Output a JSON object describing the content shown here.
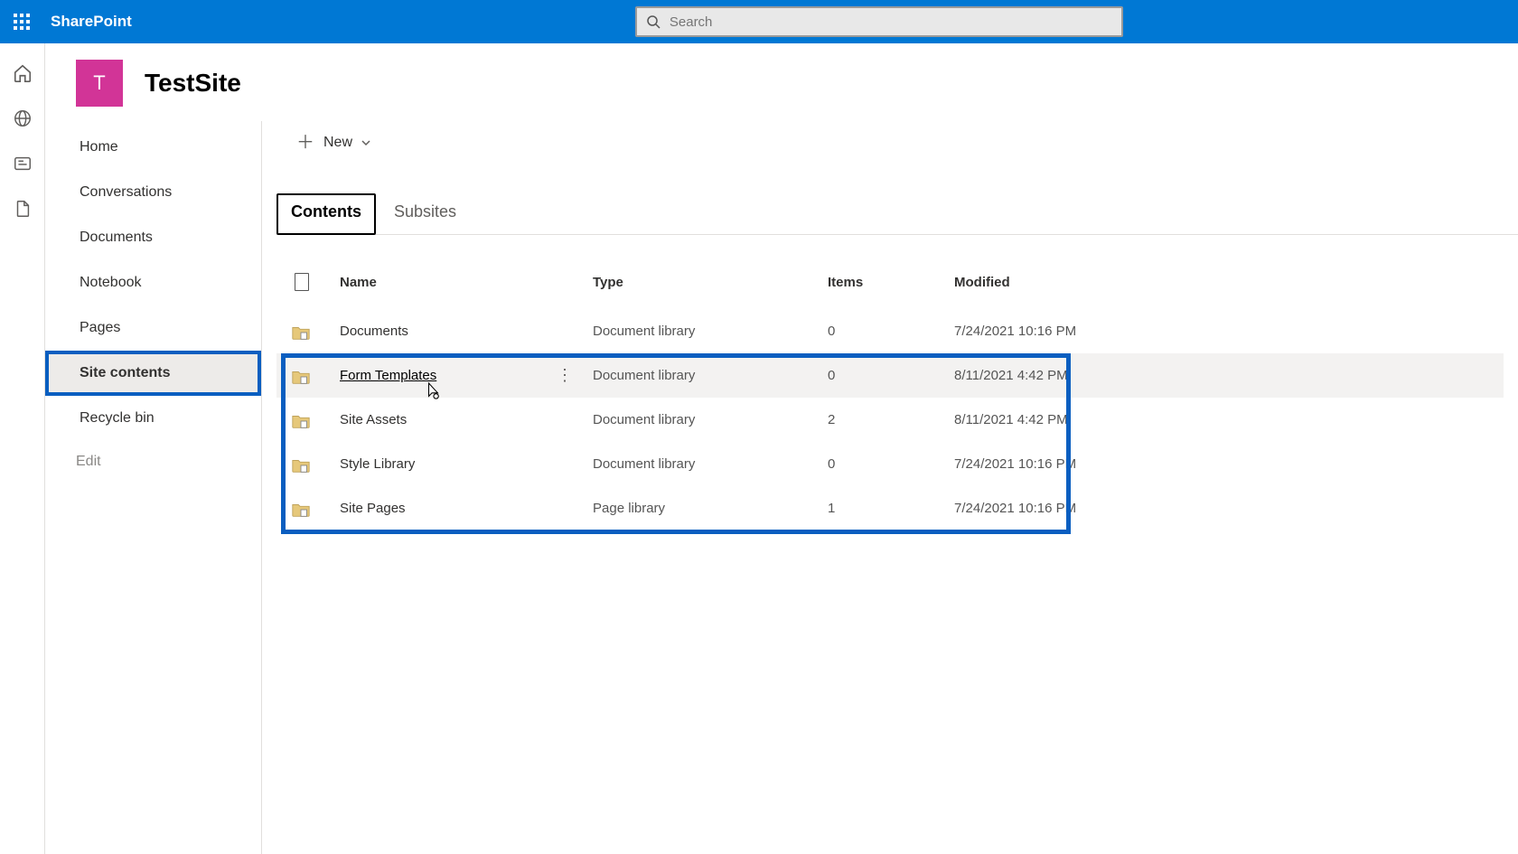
{
  "brand": "SharePoint",
  "search": {
    "placeholder": "Search"
  },
  "site": {
    "initial": "T",
    "title": "TestSite"
  },
  "nav": {
    "items": [
      {
        "label": "Home"
      },
      {
        "label": "Conversations"
      },
      {
        "label": "Documents"
      },
      {
        "label": "Notebook"
      },
      {
        "label": "Pages"
      },
      {
        "label": "Site contents"
      },
      {
        "label": "Recycle bin"
      }
    ],
    "edit": "Edit"
  },
  "command": {
    "new": "New"
  },
  "tabs": {
    "contents": "Contents",
    "subsites": "Subsites"
  },
  "table": {
    "headers": {
      "name": "Name",
      "type": "Type",
      "items": "Items",
      "modified": "Modified"
    },
    "rows": [
      {
        "name": "Documents",
        "type": "Document library",
        "items": "0",
        "modified": "7/24/2021 10:16 PM",
        "hovered": false
      },
      {
        "name": "Form Templates",
        "type": "Document library",
        "items": "0",
        "modified": "8/11/2021 4:42 PM",
        "hovered": true
      },
      {
        "name": "Site Assets",
        "type": "Document library",
        "items": "2",
        "modified": "8/11/2021 4:42 PM",
        "hovered": false
      },
      {
        "name": "Style Library",
        "type": "Document library",
        "items": "0",
        "modified": "7/24/2021 10:16 PM",
        "hovered": false
      },
      {
        "name": "Site Pages",
        "type": "Page library",
        "items": "1",
        "modified": "7/24/2021 10:16 PM",
        "hovered": false
      }
    ]
  }
}
